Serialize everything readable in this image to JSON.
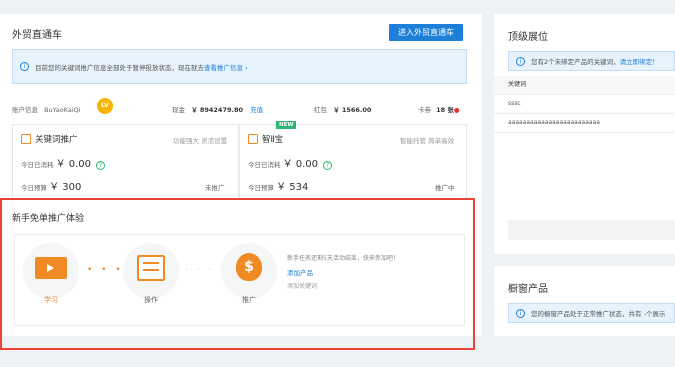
{
  "left_card": {
    "title": "外贸直通车",
    "enter_button": "进入外贸直通车",
    "notice_text": "目前您的关键词推广信息全部处于暂停投放状态，现在就去",
    "notice_link": "查看推广信息 ›"
  },
  "account": {
    "label": "账户信息",
    "name": "BuYaoKaiQi",
    "badge": "LV",
    "balance_label": "现金",
    "balance": "￥ 8942479.80",
    "recharge": "充值",
    "credit_label": "红包",
    "credit": "￥ 1566.00",
    "card_label": "卡券",
    "card_count": "18 张"
  },
  "keyword_promo": {
    "title": "关键词推广",
    "right_text": "功能强大 灵活设置",
    "spent_label": "今日已消耗",
    "spent": "￥ 0.00",
    "budget_label": "今日预算",
    "budget": "￥ 300",
    "status": "未推广"
  },
  "smart_promo": {
    "badge": "NEW",
    "title": "智Ⅱ宝",
    "right_text": "智能托管 简单高效",
    "spent_label": "今日已消耗",
    "spent": "￥ 0.00",
    "budget_label": "今日预算",
    "budget": "￥ 534",
    "status": "推广中"
  },
  "experience": {
    "title": "新手免单推广体验",
    "steps": [
      {
        "label": "学习",
        "icon": "screen-icon"
      },
      {
        "label": "操作",
        "icon": "checklist-icon"
      },
      {
        "label": "推广",
        "icon": "money-bag-icon"
      }
    ],
    "desc": "新手任务还剩5天活动结束，快来参加吧！",
    "link1": "添加产品",
    "link2": "添加关键词"
  },
  "right_top": {
    "title": "顶级展位",
    "notice_text": "您有2个未绑定产品的关键词，",
    "notice_link": "请立即绑定！",
    "col_header": "关键词",
    "rows": [
      "sssc",
      "aaaaaaaaaaaaaaaaaaaaaaaaa"
    ]
  },
  "right_bot": {
    "title": "橱窗产品",
    "notice_text": "您的橱窗产品处于正常推广状态，共有 -个展示"
  },
  "colors": {
    "accent": "#1e7fd8",
    "orange": "#f08a24",
    "highlight": "#e8443a"
  }
}
